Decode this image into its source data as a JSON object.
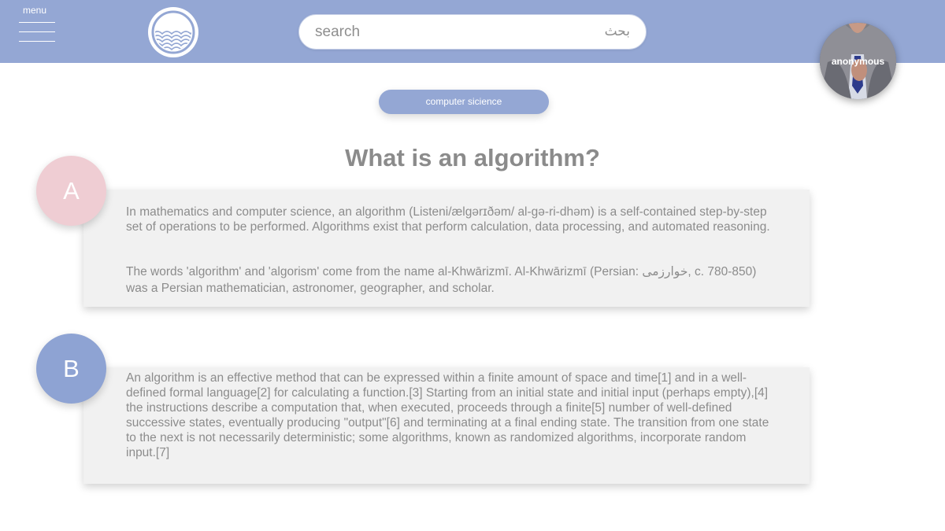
{
  "header": {
    "menu_label": "menu",
    "search": {
      "placeholder": "search",
      "rtl_label": "بحث"
    },
    "user": {
      "name": "anonymous"
    }
  },
  "category_tag": "computer sicience",
  "question_title": "What is an algorithm?",
  "answers": [
    {
      "letter": "A",
      "paragraphs": [
        "In mathematics and computer science, an algorithm (Listeni/ælgərɪðəm/ al-gə-ri-dhəm) is a self-contained step-by-step set of operations to be performed. Algorithms exist that perform calculation, data processing, and automated reasoning.",
        "The words 'algorithm' and 'algorism' come from the name al-Khwārizmī. Al-Khwārizmī (Persian: خوارزمی, c. 780-850) was a Persian mathematician, astronomer, geographer, and scholar."
      ]
    },
    {
      "letter": "B",
      "paragraphs": [
        "An algorithm is an effective method that can be expressed within a finite amount of space and time[1] and in a well-defined formal language[2] for calculating a function.[3] Starting from an initial state and initial input (perhaps empty),[4] the instructions describe a computation that, when executed, proceeds through a finite[5] number of well-defined successive states, eventually producing \"output\"[6] and terminating at a final ending state. The transition from one state to the next is not necessarily deterministic; some algorithms, known as randomized algorithms, incorporate random input.[7]"
      ]
    }
  ],
  "colors": {
    "header_bg": "#94a7d4",
    "badge_a": "#efcdd3",
    "badge_b": "#8ea3d3",
    "card_bg": "#f1f1f1"
  },
  "icons": [
    "hamburger-menu-icon",
    "wave-logo-icon",
    "user-avatar-photo"
  ]
}
